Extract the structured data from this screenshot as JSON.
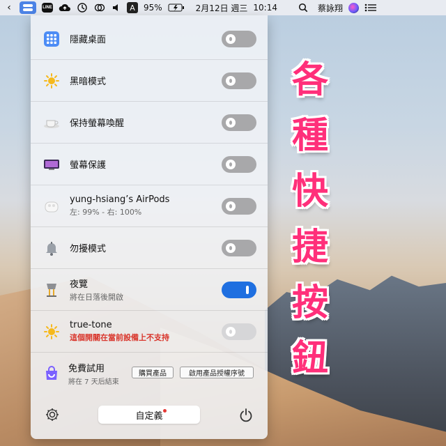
{
  "menubar": {
    "battery": "95%",
    "date": "2月12日 週三",
    "time": "10:14",
    "user": "蔡詠翔",
    "line_label": "LINE",
    "input_method": "A"
  },
  "rows": [
    {
      "title": "隱藏桌面",
      "subtitle": "",
      "icon": "grid-icon",
      "toggle": "off"
    },
    {
      "title": "黑暗模式",
      "subtitle": "",
      "icon": "sun-icon",
      "toggle": "off"
    },
    {
      "title": "保持螢幕喚醒",
      "subtitle": "",
      "icon": "coffee-icon",
      "toggle": "off"
    },
    {
      "title": "螢幕保護",
      "subtitle": "",
      "icon": "screensaver-icon",
      "toggle": "off"
    },
    {
      "title": "yung-hsiang’s AirPods",
      "subtitle": "左: 99% - 右: 100%",
      "icon": "airpods-icon",
      "toggle": "off"
    },
    {
      "title": "勿擾模式",
      "subtitle": "",
      "icon": "bell-icon",
      "toggle": "off"
    },
    {
      "title": "夜覽",
      "subtitle": "將在日落後開啟",
      "icon": "lamp-icon",
      "toggle": "on"
    },
    {
      "title": "true-tone",
      "subtitle": "這個開關在當前設備上不支持",
      "icon": "sun-icon",
      "toggle": "disabled"
    }
  ],
  "trial": {
    "title": "免費試用",
    "subtitle": "將在 7 天后結束",
    "buy_label": "購買產品",
    "activate_label": "啟用產品授權序號"
  },
  "footer": {
    "custom_label": "自定義"
  },
  "overlay": {
    "chars": [
      "各",
      "種",
      "快",
      "捷",
      "按",
      "鈕"
    ],
    "color": "#ff2f7a"
  },
  "colors": {
    "toggle_on": "#1f6fe0",
    "toggle_off": "#a8a8aa",
    "warning": "#d9352b"
  }
}
